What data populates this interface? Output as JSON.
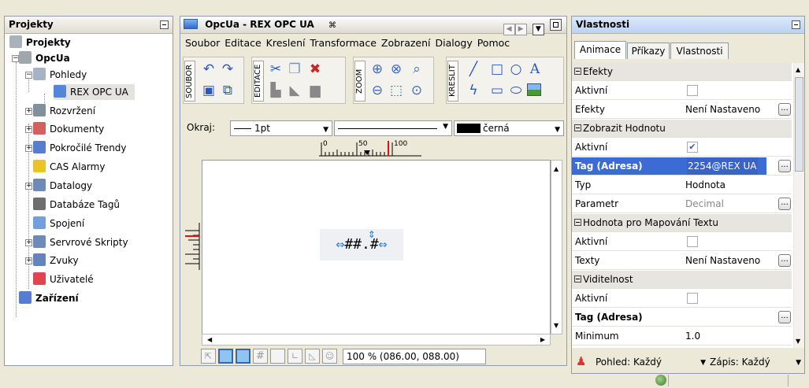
{
  "projects_panel": {
    "title": "Projekty",
    "tree": [
      {
        "label": "Projekty",
        "bold": true,
        "icon": "projects-root-icon"
      },
      {
        "label": "OpcUa",
        "bold": true,
        "icon": "project-computer-icon"
      },
      {
        "label": "Pohledy",
        "bold": false,
        "icon": "views-folder-icon"
      },
      {
        "label": "REX OPC UA",
        "bold": false,
        "icon": "screen-view-icon"
      },
      {
        "label": "Rozvržení",
        "bold": false,
        "icon": "layout-icon"
      },
      {
        "label": "Dokumenty",
        "bold": false,
        "icon": "document-icon"
      },
      {
        "label": "Pokročilé Trendy",
        "bold": false,
        "icon": "trend-icon"
      },
      {
        "label": "CAS Alarmy",
        "bold": false,
        "icon": "alarm-bell-icon"
      },
      {
        "label": "Datalogy",
        "bold": false,
        "icon": "datalog-icon"
      },
      {
        "label": "Databáze Tagů",
        "bold": false,
        "icon": "database-icon"
      },
      {
        "label": "Spojení",
        "bold": false,
        "icon": "connection-icon"
      },
      {
        "label": "Servrové Skripty",
        "bold": false,
        "icon": "script-icon"
      },
      {
        "label": "Zvuky",
        "bold": false,
        "icon": "speaker-icon"
      },
      {
        "label": "Uživatelé",
        "bold": false,
        "icon": "users-icon"
      },
      {
        "label": "Zařízení",
        "bold": true,
        "icon": "devices-icon"
      }
    ]
  },
  "editor": {
    "tab_title": "OpcUa - REX OPC UA",
    "tab_close": "⌘",
    "menu": [
      "Soubor",
      "Editace",
      "Kreslení",
      "Transformace",
      "Zobrazení",
      "Dialogy",
      "Pomoc"
    ],
    "toolbar_groups": [
      "SOUBOR",
      "EDITACE",
      "ZOOM",
      "KRESLIT"
    ],
    "border_label": "Okraj:",
    "border_width": "1pt",
    "border_color": "černá",
    "ruler_ticks": [
      "0",
      "50",
      "100"
    ],
    "canvas_widget_text": "##.#",
    "zoom_status": "100 % (086.00, 088.00)"
  },
  "properties_panel": {
    "title": "Vlastnosti",
    "tabs": [
      "Animace",
      "Příkazy",
      "Vlastnosti"
    ],
    "active_tab": 0,
    "rows": [
      {
        "type": "section",
        "key": "Efekty"
      },
      {
        "type": "checkbox",
        "key": "Aktivní",
        "checked": false
      },
      {
        "type": "value",
        "key": "Efekty",
        "value": "Není Nastaveno",
        "button": true
      },
      {
        "type": "section",
        "key": "Zobrazit Hodnotu"
      },
      {
        "type": "checkbox",
        "key": "Aktivní",
        "checked": true
      },
      {
        "type": "value",
        "key": "Tag (Adresa)",
        "value": "2254@REX UA",
        "button": true,
        "selected": true,
        "bold": true
      },
      {
        "type": "value",
        "key": "Typ",
        "value": "Hodnota",
        "button": false
      },
      {
        "type": "value",
        "key": "Parametr",
        "value": "Decimal",
        "button": true,
        "muted": true
      },
      {
        "type": "section",
        "key": "Hodnota pro Mapování Textu"
      },
      {
        "type": "checkbox",
        "key": "Aktivní",
        "checked": false
      },
      {
        "type": "value",
        "key": "Texty",
        "value": "Není Nastaveno",
        "button": true
      },
      {
        "type": "section",
        "key": "Viditelnost"
      },
      {
        "type": "checkbox",
        "key": "Aktivní",
        "checked": false
      },
      {
        "type": "value",
        "key": "Tag (Adresa)",
        "value": "",
        "button": true,
        "bold": true
      },
      {
        "type": "value",
        "key": "Minimum",
        "value": "1.0",
        "button": false
      }
    ],
    "view_filter": "Pohled: Každý",
    "write_filter": "Zápis: Každý"
  },
  "colors": {
    "selection": "#3d6bd6",
    "panel_border": "#8e9bb0",
    "canvas_bg": "#ffffff",
    "editor_bg": "#ece9d8"
  }
}
